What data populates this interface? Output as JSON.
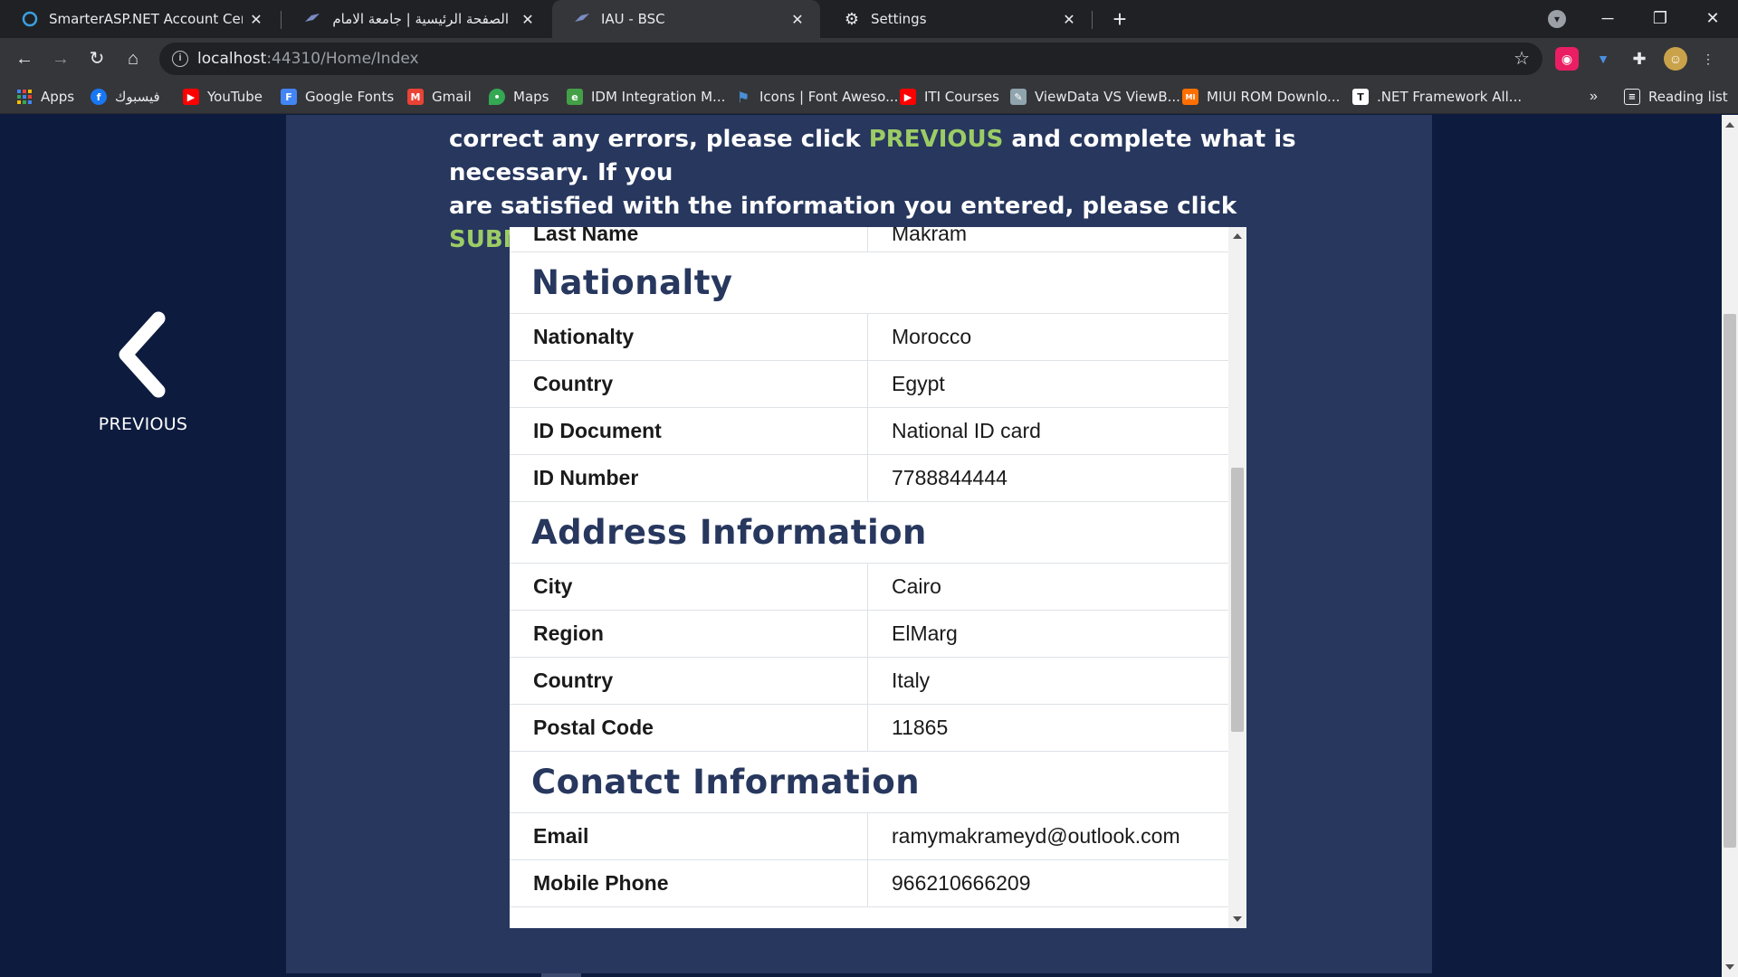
{
  "browser": {
    "tabs": [
      {
        "title": "SmarterASP.NET Account Center",
        "icon": "smarterasp-icon"
      },
      {
        "title": "الصفحة الرئيسية | جامعة الامام عبد",
        "icon": "university-icon"
      },
      {
        "title": "IAU - BSC",
        "icon": "university-icon",
        "active": true
      },
      {
        "title": "Settings",
        "icon": "gear-icon"
      }
    ],
    "address": {
      "host": "localhost",
      "path": ":44310/Home/Index"
    },
    "bookmarks": [
      {
        "label": "Apps",
        "icon": "apps-grid-icon",
        "color": "#e53935"
      },
      {
        "label": "فيسبوك",
        "icon": "facebook-icon",
        "color": "#1877f2"
      },
      {
        "label": "YouTube",
        "icon": "youtube-icon",
        "color": "#ff0000"
      },
      {
        "label": "Google Fonts",
        "icon": "google-fonts-icon",
        "color": "#4285f4"
      },
      {
        "label": "Gmail",
        "icon": "gmail-icon",
        "color": "#ea4335"
      },
      {
        "label": "Maps",
        "icon": "maps-pin-icon",
        "color": "#34a853"
      },
      {
        "label": "IDM Integration M...",
        "icon": "idm-icon",
        "color": "#43a047"
      },
      {
        "label": "Icons | Font Aweso...",
        "icon": "font-awesome-flag-icon",
        "color": "#4a90d9"
      },
      {
        "label": "ITI Courses",
        "icon": "youtube-icon",
        "color": "#ff0000"
      },
      {
        "label": "ViewData VS ViewB...",
        "icon": "page-icon",
        "color": "#90a4ae"
      },
      {
        "label": "MIUI ROM Downlo...",
        "icon": "miui-icon",
        "color": "#ff6f00"
      },
      {
        "label": ".NET Framework All...",
        "icon": "dotnet-icon",
        "color": "#ffffff"
      }
    ],
    "bookmarks_more": "»",
    "reading_list": "Reading list"
  },
  "page": {
    "instructions": {
      "line1": "correct any errors, please click ",
      "prev_word": "PREVIOUS",
      "line1_end": " and complete what is necessary. If you",
      "line2": "are satisfied with the information you entered, please click ",
      "submit_word": "SUBMIT"
    },
    "previous_label": "PREVIOUS",
    "colors": {
      "accent_green": "#9ccc65",
      "panel": "#27375e",
      "background": "#0d1b3e"
    },
    "summary": {
      "partial_row": {
        "key": "Last Name",
        "value": "Makram"
      },
      "sections": [
        {
          "title": "Nationalty",
          "rows": [
            {
              "key": "Nationalty",
              "value": "Morocco"
            },
            {
              "key": "Country",
              "value": "Egypt"
            },
            {
              "key": "ID Document",
              "value": "National ID card"
            },
            {
              "key": "ID Number",
              "value": "7788844444"
            }
          ]
        },
        {
          "title": "Address Information",
          "rows": [
            {
              "key": "City",
              "value": "Cairo"
            },
            {
              "key": "Region",
              "value": "ElMarg"
            },
            {
              "key": "Country",
              "value": "Italy"
            },
            {
              "key": "Postal Code",
              "value": "11865"
            }
          ]
        },
        {
          "title": "Conatct Information",
          "rows": [
            {
              "key": "Email",
              "value": "ramymakrameyd@outlook.com"
            },
            {
              "key": "Mobile Phone",
              "value": "966210666209"
            }
          ]
        }
      ]
    }
  }
}
